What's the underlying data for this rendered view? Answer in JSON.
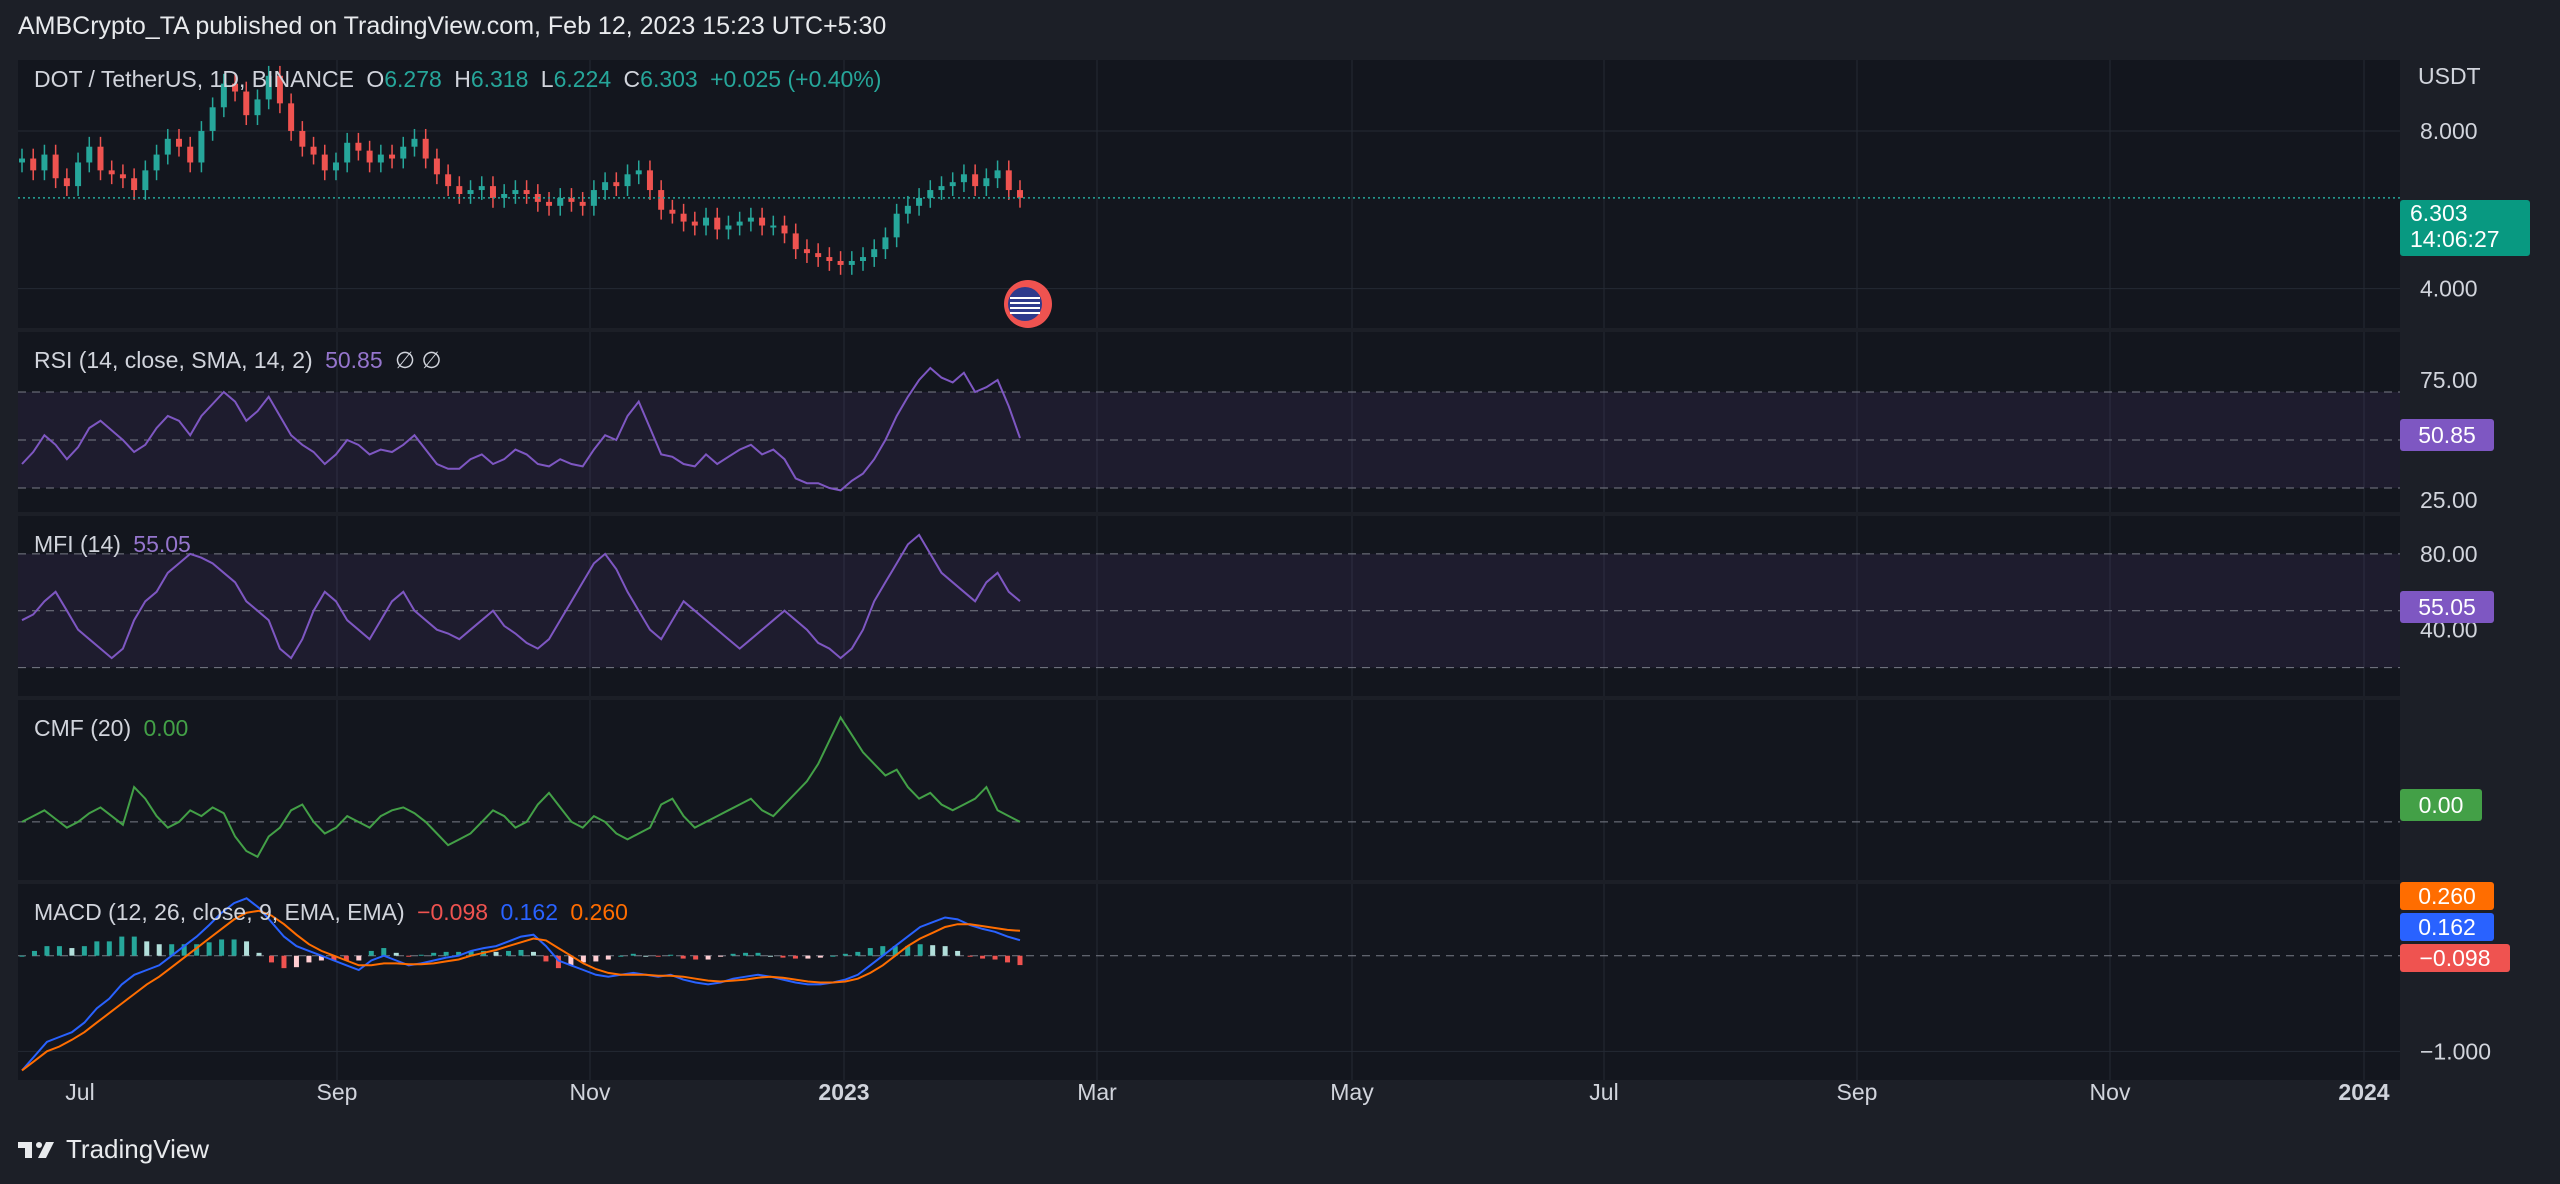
{
  "header": {
    "publisher_text": "AMBCrypto_TA published on TradingView.com, Feb 12, 2023 15:23 UTC+5:30"
  },
  "footer": {
    "brand": "TradingView"
  },
  "colors": {
    "background": "#1c1f27",
    "pane_bg": "#13161e",
    "up": "#26a69a",
    "down": "#ef5350",
    "rsi": "#7e57c2",
    "mfi": "#7e57c2",
    "cmf": "#43a047",
    "macd": "#2962ff",
    "signal": "#ff6d00"
  },
  "price_pane": {
    "symbol": "DOT / TetherUS, 1D, BINANCE",
    "o_label": "O",
    "o_val": "6.278",
    "h_label": "H",
    "h_val": "6.318",
    "l_label": "L",
    "l_val": "6.224",
    "c_label": "C",
    "c_val": "6.303",
    "change": "+0.025 (+0.40%)",
    "currency": "USDT",
    "last_price": "6.303",
    "countdown": "14:06:27"
  },
  "rsi_pane": {
    "title": "RSI (14, close, SMA, 14, 2)",
    "value": "50.85",
    "extra": "∅ ∅"
  },
  "mfi_pane": {
    "title": "MFI (14)",
    "value": "55.05"
  },
  "cmf_pane": {
    "title": "CMF (20)",
    "value": "0.00"
  },
  "macd_pane": {
    "title": "MACD (12, 26, close, 9, EMA, EMA)",
    "hist": "−0.098",
    "macd": "0.162",
    "signal": "0.260"
  },
  "chart_data": [
    {
      "type": "candlestick",
      "title": "DOT / TetherUS, 1D, BINANCE",
      "y_ticks": [
        "8.000",
        "4.000"
      ],
      "x_ticks": [
        "Jul",
        "Sep",
        "Nov",
        "2023",
        "Mar",
        "May",
        "Jul",
        "Sep",
        "Nov",
        "2024"
      ],
      "close_series": [
        7.3,
        7.0,
        7.4,
        6.8,
        6.6,
        7.2,
        7.6,
        7.0,
        6.9,
        6.8,
        6.5,
        7.0,
        7.4,
        7.8,
        7.6,
        7.2,
        8.0,
        8.6,
        9.2,
        9.0,
        8.4,
        8.8,
        9.4,
        8.7,
        8.0,
        7.6,
        7.4,
        7.0,
        7.2,
        7.7,
        7.5,
        7.2,
        7.4,
        7.3,
        7.6,
        7.8,
        7.3,
        6.9,
        6.6,
        6.4,
        6.5,
        6.6,
        6.3,
        6.4,
        6.5,
        6.4,
        6.2,
        6.1,
        6.3,
        6.2,
        6.1,
        6.5,
        6.7,
        6.6,
        6.9,
        7.0,
        6.5,
        6.0,
        5.9,
        5.7,
        5.6,
        5.8,
        5.5,
        5.6,
        5.7,
        5.8,
        5.6,
        5.6,
        5.4,
        5.0,
        4.9,
        4.8,
        4.7,
        4.6,
        4.7,
        4.8,
        5.0,
        5.3,
        5.9,
        6.1,
        6.3,
        6.5,
        6.6,
        6.7,
        6.9,
        6.6,
        6.8,
        7.0,
        6.5,
        6.303
      ],
      "last": 6.303
    },
    {
      "type": "line",
      "name": "RSI",
      "y_ticks": [
        "75.00",
        "25.00"
      ],
      "bands": [
        70,
        50,
        30
      ],
      "last": 50.85,
      "values": [
        40,
        45,
        52,
        48,
        42,
        47,
        55,
        58,
        54,
        50,
        45,
        48,
        55,
        60,
        58,
        52,
        60,
        65,
        70,
        66,
        58,
        62,
        68,
        60,
        52,
        48,
        45,
        40,
        44,
        50,
        48,
        44,
        46,
        45,
        48,
        52,
        46,
        40,
        38,
        38,
        42,
        44,
        40,
        42,
        46,
        44,
        40,
        39,
        42,
        40,
        39,
        46,
        52,
        50,
        60,
        66,
        55,
        44,
        43,
        40,
        39,
        44,
        40,
        43,
        46,
        48,
        44,
        46,
        42,
        34,
        32,
        32,
        30,
        29,
        33,
        36,
        42,
        50,
        60,
        68,
        75,
        80,
        76,
        74,
        78,
        70,
        72,
        75,
        64,
        50.85
      ]
    },
    {
      "type": "line",
      "name": "MFI",
      "y_ticks": [
        "80.00",
        "40.00"
      ],
      "bands": [
        80,
        50,
        20
      ],
      "last": 55.05,
      "values": [
        45,
        48,
        55,
        60,
        50,
        40,
        35,
        30,
        25,
        30,
        45,
        55,
        60,
        70,
        75,
        80,
        78,
        75,
        70,
        65,
        55,
        50,
        45,
        30,
        25,
        35,
        50,
        60,
        55,
        45,
        40,
        35,
        45,
        55,
        60,
        50,
        45,
        40,
        38,
        35,
        40,
        45,
        50,
        42,
        38,
        33,
        30,
        35,
        45,
        55,
        65,
        75,
        80,
        72,
        60,
        50,
        40,
        35,
        45,
        55,
        50,
        45,
        40,
        35,
        30,
        35,
        40,
        45,
        50,
        45,
        40,
        33,
        30,
        25,
        30,
        40,
        55,
        65,
        75,
        85,
        90,
        80,
        70,
        65,
        60,
        55,
        65,
        70,
        60,
        55.05
      ]
    },
    {
      "type": "line",
      "name": "CMF",
      "y_ticks": [],
      "zero": 0,
      "last": 0.0,
      "values": [
        0.0,
        0.02,
        0.04,
        0.01,
        -0.02,
        0.0,
        0.03,
        0.05,
        0.02,
        -0.01,
        0.12,
        0.08,
        0.02,
        -0.02,
        0.0,
        0.04,
        0.02,
        0.05,
        0.03,
        -0.05,
        -0.1,
        -0.12,
        -0.05,
        -0.02,
        0.04,
        0.06,
        0.0,
        -0.04,
        -0.02,
        0.02,
        0.0,
        -0.02,
        0.02,
        0.04,
        0.05,
        0.03,
        0.0,
        -0.04,
        -0.08,
        -0.06,
        -0.04,
        0.0,
        0.04,
        0.02,
        -0.02,
        0.0,
        0.06,
        0.1,
        0.05,
        0.0,
        -0.02,
        0.02,
        0.0,
        -0.04,
        -0.06,
        -0.04,
        -0.02,
        0.06,
        0.08,
        0.02,
        -0.02,
        0.0,
        0.02,
        0.04,
        0.06,
        0.08,
        0.04,
        0.02,
        0.06,
        0.1,
        0.14,
        0.2,
        0.28,
        0.36,
        0.3,
        0.24,
        0.2,
        0.16,
        0.18,
        0.12,
        0.08,
        0.1,
        0.06,
        0.04,
        0.06,
        0.08,
        0.12,
        0.04,
        0.02,
        0.0
      ]
    },
    {
      "type": "line",
      "name": "MACD",
      "y_ticks": [
        "−1.000"
      ],
      "zero": 0,
      "macd": [
        -1.2,
        -1.05,
        -0.9,
        -0.85,
        -0.8,
        -0.7,
        -0.55,
        -0.45,
        -0.3,
        -0.2,
        -0.15,
        -0.1,
        0.0,
        0.1,
        0.2,
        0.32,
        0.45,
        0.55,
        0.6,
        0.5,
        0.35,
        0.2,
        0.1,
        0.05,
        0.0,
        -0.05,
        -0.1,
        -0.15,
        -0.05,
        0.0,
        -0.05,
        -0.1,
        -0.08,
        -0.05,
        -0.02,
        0.0,
        0.05,
        0.08,
        0.1,
        0.15,
        0.2,
        0.22,
        0.1,
        -0.05,
        -0.1,
        -0.15,
        -0.2,
        -0.22,
        -0.2,
        -0.18,
        -0.2,
        -0.22,
        -0.2,
        -0.25,
        -0.28,
        -0.3,
        -0.28,
        -0.24,
        -0.22,
        -0.2,
        -0.22,
        -0.25,
        -0.28,
        -0.3,
        -0.3,
        -0.28,
        -0.25,
        -0.2,
        -0.1,
        0.0,
        0.1,
        0.2,
        0.3,
        0.35,
        0.4,
        0.38,
        0.32,
        0.28,
        0.25,
        0.2,
        0.162
      ],
      "signal": [
        -1.2,
        -1.1,
        -1.0,
        -0.95,
        -0.88,
        -0.8,
        -0.7,
        -0.6,
        -0.5,
        -0.4,
        -0.3,
        -0.22,
        -0.12,
        -0.02,
        0.08,
        0.18,
        0.28,
        0.38,
        0.45,
        0.47,
        0.42,
        0.33,
        0.22,
        0.12,
        0.05,
        0.0,
        -0.05,
        -0.1,
        -0.1,
        -0.08,
        -0.08,
        -0.09,
        -0.09,
        -0.08,
        -0.06,
        -0.04,
        0.0,
        0.03,
        0.06,
        0.1,
        0.14,
        0.18,
        0.16,
        0.08,
        0.0,
        -0.08,
        -0.14,
        -0.18,
        -0.2,
        -0.2,
        -0.2,
        -0.21,
        -0.21,
        -0.22,
        -0.24,
        -0.26,
        -0.27,
        -0.26,
        -0.25,
        -0.23,
        -0.22,
        -0.23,
        -0.25,
        -0.27,
        -0.28,
        -0.28,
        -0.27,
        -0.24,
        -0.18,
        -0.1,
        0.0,
        0.1,
        0.18,
        0.24,
        0.3,
        0.33,
        0.33,
        0.31,
        0.29,
        0.27,
        0.26
      ],
      "last_macd": 0.162,
      "last_signal": 0.26,
      "last_hist": -0.098
    }
  ]
}
